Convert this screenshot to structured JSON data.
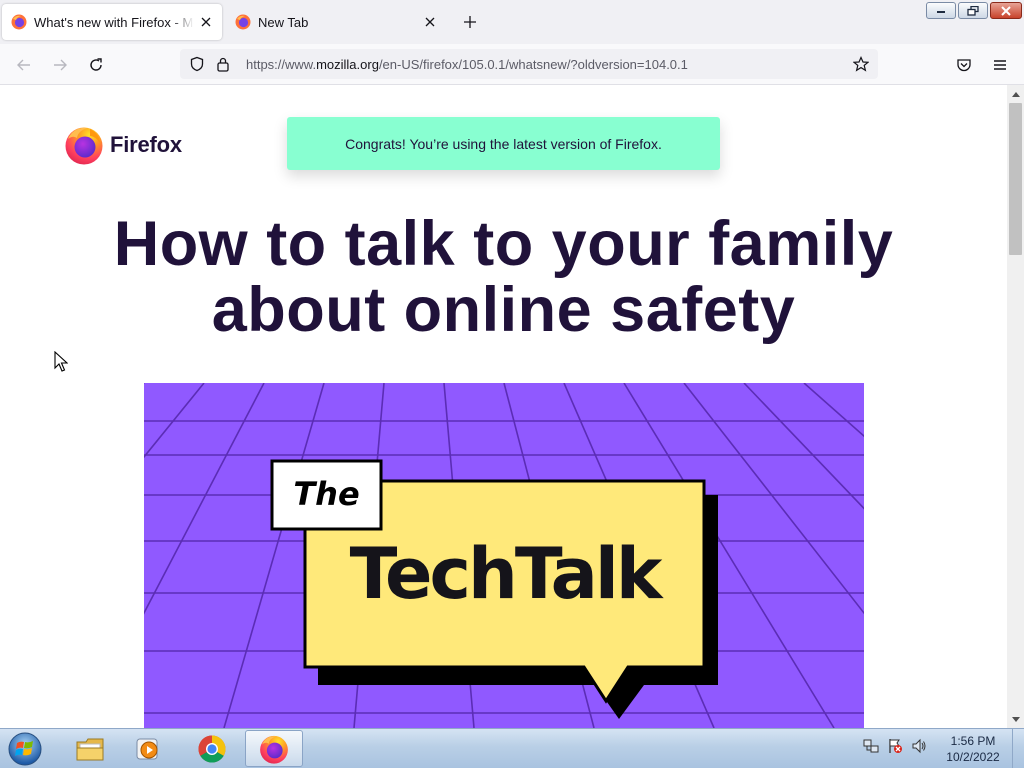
{
  "browser": {
    "tabs": [
      {
        "label": "What's new with Firefox - More",
        "favicon": "firefox-icon",
        "active": true
      },
      {
        "label": "New Tab",
        "favicon": "firefox-icon",
        "active": false
      }
    ],
    "url": {
      "prefix": "https://www.",
      "host": "mozilla.org",
      "path": "/en-US/firefox/105.0.1/whatsnew/?oldversion=104.0.1"
    }
  },
  "page": {
    "brand": "Firefox",
    "notice": "Congrats! You’re using the latest version of Firefox.",
    "headline_line1": "How to talk to your family",
    "headline_line2": "about online safety",
    "hero": {
      "tag": "The",
      "title": "TechTalk",
      "background": "#9059ff",
      "card_color": "#ffe97a"
    }
  },
  "taskbar": {
    "apps": [
      "windows-explorer-icon",
      "media-player-icon",
      "chrome-icon",
      "firefox-icon"
    ],
    "time": "1:56 PM",
    "date": "10/2/2022"
  },
  "colors": {
    "accent_green": "#88ffd1",
    "headline": "#20123a",
    "hero_purple": "#9059ff",
    "card_yellow": "#ffe97a"
  }
}
